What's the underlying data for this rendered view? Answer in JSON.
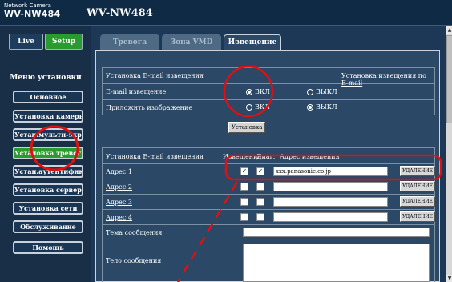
{
  "header": {
    "camera_label": "Network Camera",
    "camera_model": "WV-NW484",
    "page_title": "WV-NW484"
  },
  "sidebar": {
    "live_label": "Live",
    "setup_label": "Setup",
    "menu_title": "Меню установки",
    "items": [
      {
        "label": "Основное"
      },
      {
        "label": "Установка камеры"
      },
      {
        "label": "Устан.мульти-экрана"
      },
      {
        "label": "Установка тревоги"
      },
      {
        "label": "Устан.аутентификации"
      },
      {
        "label": "Установка сервера"
      },
      {
        "label": "Установка сети"
      },
      {
        "label": "Обслуживание"
      }
    ],
    "help_label": "Помощь"
  },
  "tabs": [
    {
      "label": "Тревога"
    },
    {
      "label": "Зона VMD"
    },
    {
      "label": "Извещение"
    }
  ],
  "email_settings": {
    "section_title": "Установка E-mail извещения",
    "section_link": "Установка извещения по E-mail",
    "notify_label": "E-mail извещение",
    "attach_label": "Приложить изображение",
    "on_label": "ВКЛ",
    "off_label": "ВЫКЛ",
    "notify_value": "ВКЛ",
    "attach_value": "ВЫКЛ",
    "set_button": "Установка"
  },
  "address_settings": {
    "section_title": "Установка E-mail извещения",
    "col_alarm": "Извещение",
    "col_diag": "Диаг.",
    "col_address": "Адрес извещения",
    "rows": [
      {
        "label": "Адрес 1",
        "alarm": true,
        "diag": true,
        "address": "xxx.panasonic.co.jp",
        "delete": "УДАЛЕНИЕ"
      },
      {
        "label": "Адрес 2",
        "alarm": false,
        "diag": false,
        "address": "",
        "delete": "УДАЛЕНИЕ"
      },
      {
        "label": "Адрес 3",
        "alarm": false,
        "diag": false,
        "address": "",
        "delete": "УДАЛЕНИЕ"
      },
      {
        "label": "Адрес 4",
        "alarm": false,
        "diag": false,
        "address": "",
        "delete": "УДАЛЕНИЕ"
      }
    ],
    "subject_label": "Тема сообщения",
    "body_label": "Тело сообщения"
  },
  "annotation_colors": {
    "circle": "#e01010",
    "arrow": "#e01010"
  }
}
